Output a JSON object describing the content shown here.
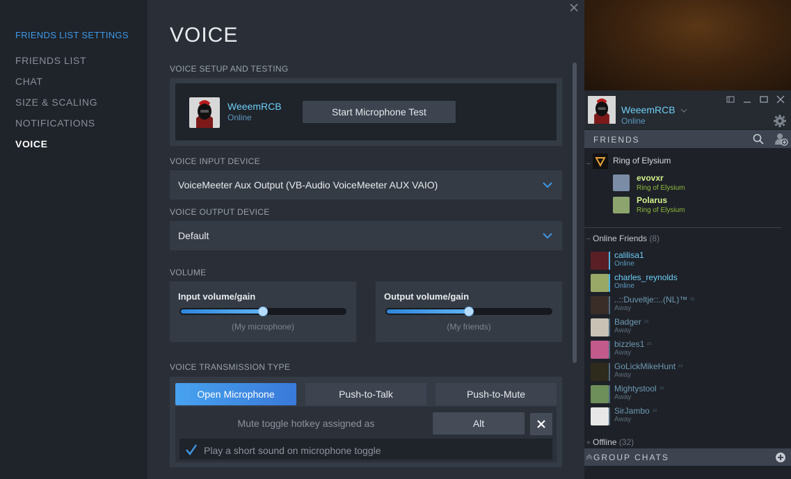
{
  "settings": {
    "nav_header": "FRIENDS LIST SETTINGS",
    "nav_items": [
      "FRIENDS LIST",
      "CHAT",
      "SIZE & SCALING",
      "NOTIFICATIONS",
      "VOICE"
    ],
    "active_item": "VOICE",
    "page_title": "VOICE",
    "setup_label": "VOICE SETUP AND TESTING",
    "user_name": "WeeemRCB",
    "user_status": "Online",
    "mic_test_button": "Start Microphone Test",
    "input_device_label": "VOICE INPUT DEVICE",
    "input_device_value": "VoiceMeeter Aux Output (VB-Audio VoiceMeeter AUX VAIO)",
    "output_device_label": "VOICE OUTPUT DEVICE",
    "output_device_value": "Default",
    "volume_label": "VOLUME",
    "input_volume_label": "Input volume/gain",
    "input_volume_sub": "(My microphone)",
    "input_volume_level": 0.5,
    "output_volume_label": "Output volume/gain",
    "output_volume_sub": "(My friends)",
    "output_volume_level": 0.5,
    "transmission_label": "VOICE TRANSMISSION TYPE",
    "transmission_options": [
      "Open Microphone",
      "Push-to-Talk",
      "Push-to-Mute"
    ],
    "transmission_selected": "Open Microphone",
    "hotkey_label": "Mute toggle hotkey assigned as",
    "hotkey_value": "Alt",
    "toggle_sound_label": "Play a short sound on microphone toggle",
    "toggle_sound_checked": true
  },
  "friends": {
    "user_name": "WeeemRCB",
    "user_status": "Online",
    "friends_tab": "FRIENDS",
    "game_group": {
      "title": "Ring of Elysium",
      "members": [
        {
          "name": "evovxr",
          "status": "Ring of Elysium"
        },
        {
          "name": "Polarus",
          "status": "Ring of Elysium"
        }
      ]
    },
    "online_header": "Online Friends",
    "online_count": "(8)",
    "online": [
      {
        "name": "calilisa1",
        "status": "Online"
      },
      {
        "name": "charles_reynolds",
        "status": "Online"
      },
      {
        "name": "..::Duveltje::..(NL)™",
        "status": "Away"
      },
      {
        "name": "Badger",
        "status": "Away"
      },
      {
        "name": "bizzles1",
        "status": "Away"
      },
      {
        "name": "GoLickMikeHunt",
        "status": "Away"
      },
      {
        "name": "Mightystool",
        "status": "Away"
      },
      {
        "name": "SirJambo",
        "status": "Away"
      }
    ],
    "offline_header": "Offline",
    "offline_count": "(32)",
    "group_chats": "GROUP CHATS"
  },
  "colors": {
    "accent": "#3d9ae8",
    "online_name": "#6dcff6",
    "in_game": "#90ba3c",
    "selected_button": "#4c8ee6"
  },
  "icons": [
    "close-icon",
    "chevron-down-icon",
    "search-icon",
    "add-friend-icon",
    "gear-icon",
    "checkmark-icon",
    "snooze-icon",
    "plus-icon"
  ]
}
